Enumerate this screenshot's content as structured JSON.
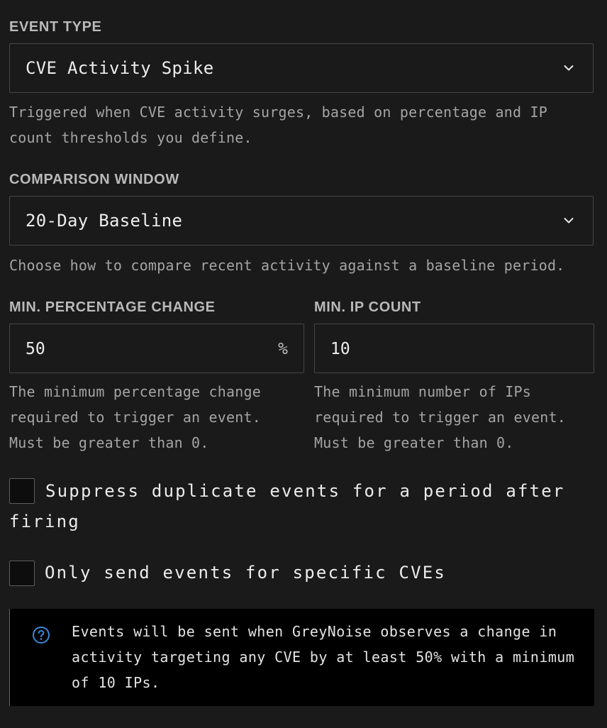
{
  "event_type": {
    "label": "EVENT TYPE",
    "selected": "CVE Activity Spike",
    "help": "Triggered when CVE activity surges, based on percentage and IP count thresholds you define."
  },
  "comparison_window": {
    "label": "COMPARISON WINDOW",
    "selected": "20-Day Baseline",
    "help": "Choose how to compare recent activity against a baseline period."
  },
  "min_percentage": {
    "label": "MIN. PERCENTAGE CHANGE",
    "value": "50",
    "suffix": "%",
    "help": "The minimum percentage change required to trigger an event. Must be greater than 0."
  },
  "min_ip_count": {
    "label": "MIN. IP COUNT",
    "value": "10",
    "help": "The minimum number of IPs required to trigger an event. Must be greater than 0."
  },
  "suppress_duplicates": {
    "checked": false,
    "label": "Suppress duplicate events for a period after firing"
  },
  "specific_cves": {
    "checked": false,
    "label": "Only send events for specific CVEs"
  },
  "info_banner": {
    "icon": "question-circle-icon",
    "text": "Events will be sent when GreyNoise observes a change in activity targeting any CVE by at least 50% with a minimum of 10 IPs."
  },
  "colors": {
    "background": "#1a1a1a",
    "border": "#454545",
    "accent": "#3a86d6",
    "info_background": "#000000"
  }
}
